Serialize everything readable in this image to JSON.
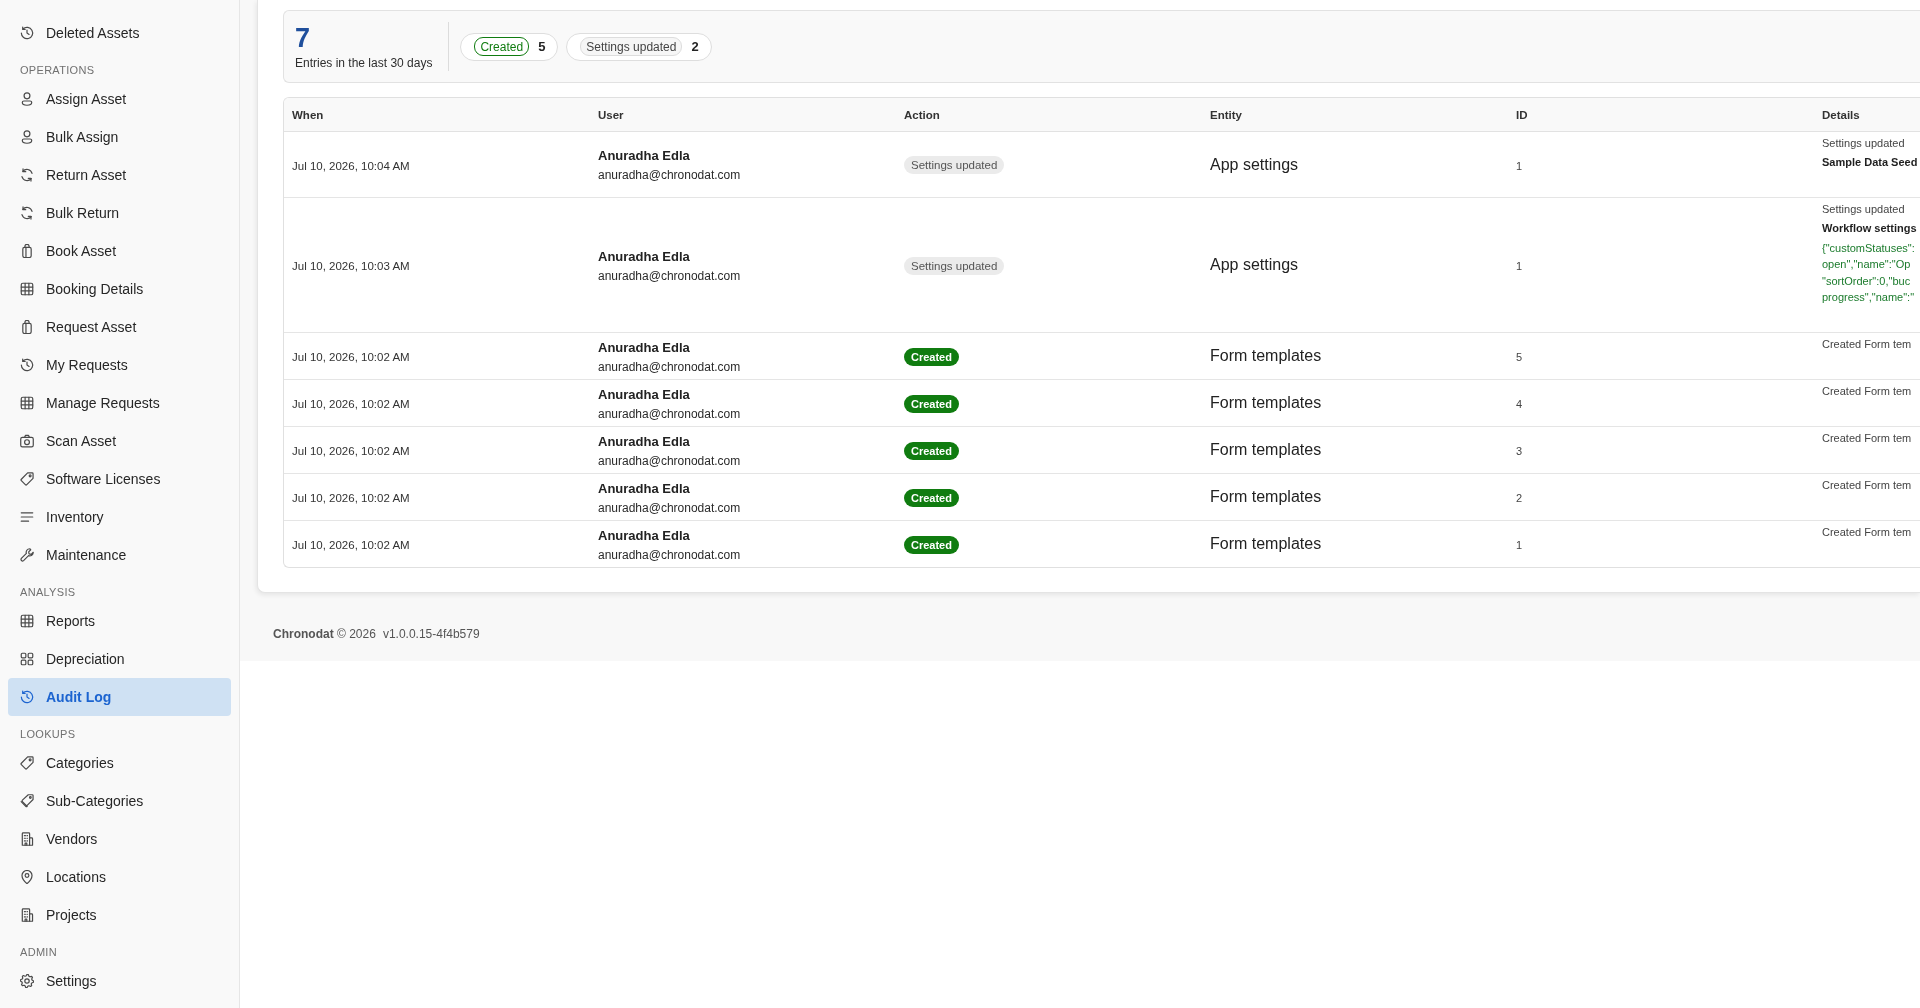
{
  "sidebar": {
    "sections": [
      {
        "items": [
          {
            "label": "Deleted Assets",
            "selected": false
          }
        ]
      },
      {
        "title": "OPERATIONS",
        "items": [
          {
            "label": "Assign Asset",
            "selected": false
          },
          {
            "label": "Bulk Assign",
            "selected": false
          },
          {
            "label": "Return Asset",
            "selected": false
          },
          {
            "label": "Bulk Return",
            "selected": false
          },
          {
            "label": "Book Asset",
            "selected": false
          },
          {
            "label": "Booking Details",
            "selected": false
          },
          {
            "label": "Request Asset",
            "selected": false
          },
          {
            "label": "My Requests",
            "selected": false
          },
          {
            "label": "Manage Requests",
            "selected": false
          },
          {
            "label": "Scan Asset",
            "selected": false
          },
          {
            "label": "Software Licenses",
            "selected": false
          },
          {
            "label": "Inventory",
            "selected": false
          },
          {
            "label": "Maintenance",
            "selected": false
          }
        ]
      },
      {
        "title": "ANALYSIS",
        "items": [
          {
            "label": "Reports",
            "selected": false
          },
          {
            "label": "Depreciation",
            "selected": false
          },
          {
            "label": "Audit Log",
            "selected": true
          }
        ]
      },
      {
        "title": "LOOKUPS",
        "items": [
          {
            "label": "Categories",
            "selected": false
          },
          {
            "label": "Sub-Categories",
            "selected": false
          },
          {
            "label": "Vendors",
            "selected": false
          },
          {
            "label": "Locations",
            "selected": false
          },
          {
            "label": "Projects",
            "selected": false
          }
        ]
      },
      {
        "title": "ADMIN",
        "items": [
          {
            "label": "Settings",
            "selected": false
          }
        ]
      }
    ]
  },
  "summary": {
    "total": "7",
    "caption": "Entries in the last 30 days",
    "counts": [
      {
        "label": "Created",
        "kind": "created",
        "count": "5"
      },
      {
        "label": "Settings updated",
        "kind": "settings",
        "count": "2"
      }
    ]
  },
  "table": {
    "columns": [
      "When",
      "User",
      "Action",
      "Entity",
      "ID",
      "Details"
    ],
    "rows": [
      {
        "when": "Jul 10, 2026, 10:04 AM",
        "user": {
          "name": "Anuradha Edla",
          "email": "anuradha@chronodat.com"
        },
        "action": {
          "label": "Settings updated",
          "kind": "settings"
        },
        "entity": "App settings",
        "id": "1",
        "details": {
          "summary": "Settings updated",
          "title": "Sample Data Seed"
        }
      },
      {
        "when": "Jul 10, 2026, 10:03 AM",
        "user": {
          "name": "Anuradha Edla",
          "email": "anuradha@chronodat.com"
        },
        "action": {
          "label": "Settings updated",
          "kind": "settings"
        },
        "entity": "App settings",
        "id": "1",
        "details": {
          "summary": "Settings updated",
          "title": "Workflow settings",
          "json_lines": [
            "{\"customStatuses\":",
            "open\",\"name\":\"Op",
            "\"sortOrder\":0,\"buc",
            "progress\",\"name\":\""
          ]
        }
      },
      {
        "when": "Jul 10, 2026, 10:02 AM",
        "user": {
          "name": "Anuradha Edla",
          "email": "anuradha@chronodat.com"
        },
        "action": {
          "label": "Created",
          "kind": "created"
        },
        "entity": "Form templates",
        "id": "5",
        "details": {
          "summary": "Created Form tem"
        }
      },
      {
        "when": "Jul 10, 2026, 10:02 AM",
        "user": {
          "name": "Anuradha Edla",
          "email": "anuradha@chronodat.com"
        },
        "action": {
          "label": "Created",
          "kind": "created"
        },
        "entity": "Form templates",
        "id": "4",
        "details": {
          "summary": "Created Form tem"
        }
      },
      {
        "when": "Jul 10, 2026, 10:02 AM",
        "user": {
          "name": "Anuradha Edla",
          "email": "anuradha@chronodat.com"
        },
        "action": {
          "label": "Created",
          "kind": "created"
        },
        "entity": "Form templates",
        "id": "3",
        "details": {
          "summary": "Created Form tem"
        }
      },
      {
        "when": "Jul 10, 2026, 10:02 AM",
        "user": {
          "name": "Anuradha Edla",
          "email": "anuradha@chronodat.com"
        },
        "action": {
          "label": "Created",
          "kind": "created"
        },
        "entity": "Form templates",
        "id": "2",
        "details": {
          "summary": "Created Form tem"
        }
      },
      {
        "when": "Jul 10, 2026, 10:02 AM",
        "user": {
          "name": "Anuradha Edla",
          "email": "anuradha@chronodat.com"
        },
        "action": {
          "label": "Created",
          "kind": "created"
        },
        "entity": "Form templates",
        "id": "1",
        "details": {
          "summary": "Created Form tem"
        }
      }
    ]
  },
  "footer": {
    "copyright": "**Chronodat** © 2026",
    "version": "v1.0.0.15-4f4b579"
  }
}
